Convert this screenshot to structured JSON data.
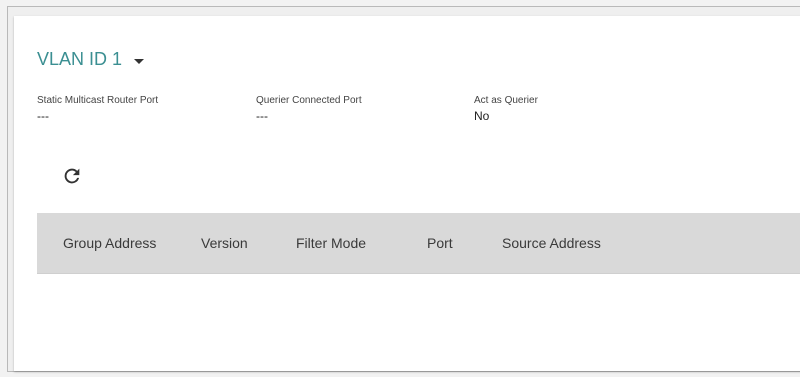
{
  "vlan": {
    "label": "VLAN ID 1"
  },
  "info": {
    "static_router_port": {
      "label": "Static Multicast Router Port",
      "value": "---"
    },
    "querier_connected_port": {
      "label": "Querier Connected Port",
      "value": "---"
    },
    "act_as_querier": {
      "label": "Act as Querier",
      "value": "No"
    }
  },
  "table": {
    "columns": [
      "Group Address",
      "Version",
      "Filter Mode",
      "Port",
      "Source Address"
    ],
    "rows": []
  },
  "colors": {
    "accent": "#3b8f92",
    "table_header_bg": "#d9d9d9"
  },
  "icons": {
    "refresh": "refresh-icon",
    "dropdown": "chevron-down-icon"
  }
}
